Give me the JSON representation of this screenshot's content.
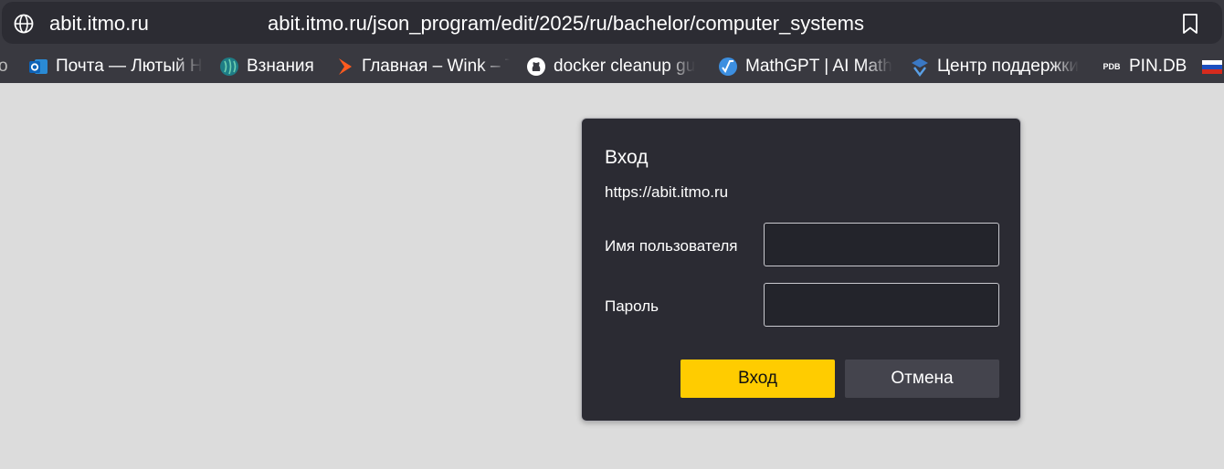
{
  "browser": {
    "host": "abit.itmo.ru",
    "url": "abit.itmo.ru/json_program/edit/2025/ru/bachelor/computer_systems",
    "bookmarks": [
      {
        "label": "о",
        "icon": "unknown-icon"
      },
      {
        "label": "Почта — Лютый Н",
        "icon": "outlook-icon"
      },
      {
        "label": "Взнания",
        "icon": "vznaniya-icon"
      },
      {
        "label": "Главная – Wink – Т",
        "icon": "wink-icon"
      },
      {
        "label": "docker cleanup gu",
        "icon": "github-icon"
      },
      {
        "label": "MathGPT | AI Math",
        "icon": "mathgpt-icon"
      },
      {
        "label": "Центр поддержки",
        "icon": "support-icon"
      },
      {
        "label": "PIN.DB",
        "icon": "pdb-icon",
        "icon_text": "PDB"
      },
      {
        "label": "",
        "icon": "flag-icon"
      }
    ]
  },
  "dialog": {
    "title": "Вход",
    "origin": "https://abit.itmo.ru",
    "username_label": "Имя пользователя",
    "username_value": "",
    "password_label": "Пароль",
    "password_value": "",
    "login_button": "Вход",
    "cancel_button": "Отмена"
  },
  "colors": {
    "page_background": "#dcdcdc",
    "toolbar": "#393940",
    "dialog_background": "#2b2b33",
    "primary_button": "#ffcc00",
    "secondary_button": "#44444d"
  }
}
